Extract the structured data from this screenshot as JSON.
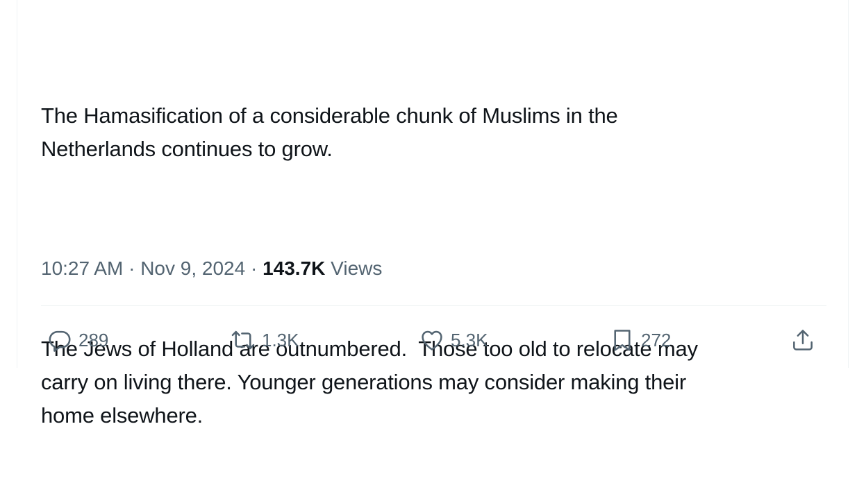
{
  "tweet": {
    "paragraphs": [
      "The Hamasification of a considerable chunk of Muslims in the\nNetherlands continues to grow.",
      "The Jews of Holland are outnumbered.  Those too old to relocate may\ncarry on living there. Younger generations may consider making their\nhome elsewhere."
    ]
  },
  "meta": {
    "time": "10:27 AM",
    "separator": "·",
    "date": "Nov 9, 2024",
    "views_count": "143.7K",
    "views_label": "Views"
  },
  "actions": {
    "reply": {
      "icon": "reply-icon",
      "count": "289"
    },
    "repost": {
      "icon": "repost-icon",
      "count": "1.3K"
    },
    "like": {
      "icon": "heart-icon",
      "count": "5.3K"
    },
    "bookmark": {
      "icon": "bookmark-icon",
      "count": "272"
    },
    "share": {
      "icon": "share-icon"
    }
  },
  "colors": {
    "text_primary": "#0f1419",
    "text_secondary": "#536471",
    "divider": "#eff3f4"
  }
}
